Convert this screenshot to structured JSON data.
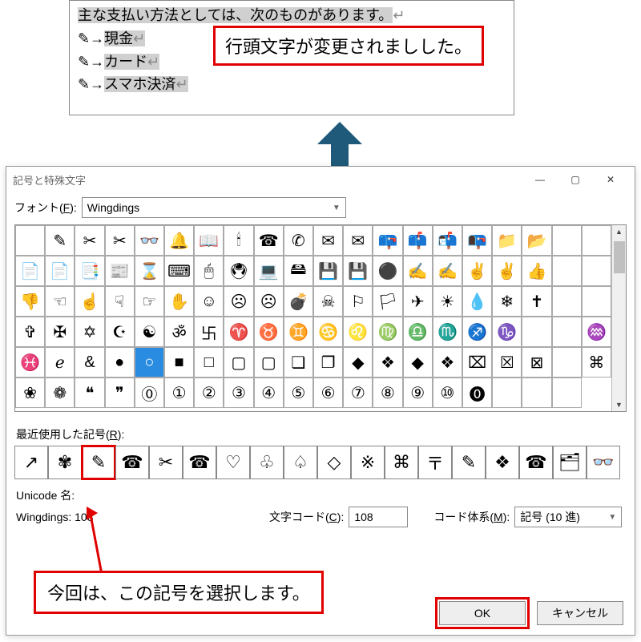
{
  "doc": {
    "heading": "主な支払い方法としては、次のものがあります。",
    "items": [
      "現金",
      "カード",
      "スマホ決済"
    ],
    "bullet_glyph": "✎",
    "tab_glyph": "→",
    "return_glyph": "↵"
  },
  "callout_top": "行頭文字が変更されましした。",
  "callout_bottom": "今回は、この記号を選択します。",
  "dialog": {
    "title": "記号と特殊文字",
    "minimize": "—",
    "maximize": "▢",
    "close": "✕",
    "font_label_pre": "フォント(",
    "font_label_key": "F",
    "font_label_post": "):",
    "font_value": "Wingdings",
    "recent_label_pre": "最近使用した記号(",
    "recent_label_key": "R",
    "recent_label_post": "):",
    "unicode_name": "Unicode 名:",
    "wingdings_name": "Wingdings: 108",
    "code_label_pre": "文字コード(",
    "code_label_key": "C",
    "code_label_post": "):",
    "code_value": "108",
    "system_label_pre": "コード体系(",
    "system_label_key": "M",
    "system_label_post": "):",
    "system_value": "記号 (10 進)",
    "ok": "OK",
    "cancel": "キャンセル",
    "grid": [
      "",
      "✎",
      "✂",
      "✂",
      "👓",
      "🔔",
      "📖",
      "🕯",
      "☎",
      "✆",
      "✉",
      "✉",
      "📪",
      "📫",
      "📬",
      "📭",
      "📁",
      "📂",
      "",
      "",
      "📄",
      "📄",
      "📑",
      "📰",
      "⌛",
      "⌨",
      "🖱",
      "🖲",
      "💻",
      "🖴",
      "💾",
      "💾",
      "⚫",
      "✍",
      "✍",
      "✌",
      "✌",
      "👍",
      "",
      "",
      "👎",
      "☜",
      "☝",
      "☟",
      "☞",
      "✋",
      "☺",
      "☹",
      "☹",
      "💣",
      "☠",
      "⚐",
      "🏳",
      "✈",
      "☀",
      "💧",
      "❄",
      "✝",
      "",
      "",
      "✞",
      "✠",
      "✡",
      "☪",
      "☯",
      "ॐ",
      "卐",
      "♈",
      "♉",
      "♊",
      "♋",
      "♌",
      "♍",
      "♎",
      "♏",
      "♐",
      "♑",
      "",
      "",
      "♒",
      "♓",
      "ℯ",
      "&",
      "●",
      "○",
      "■",
      "□",
      "▢",
      "▢",
      "❏",
      "❐",
      "◆",
      "❖",
      "◆",
      "❖",
      "⌧",
      "☒",
      "⊠",
      "",
      "⌘",
      "❀",
      "❁",
      "❝",
      "❞",
      "⓪",
      "①",
      "②",
      "③",
      "④",
      "⑤",
      "⑥",
      "⑦",
      "⑧",
      "⑨",
      "⑩",
      "⓿",
      "",
      "",
      ""
    ],
    "grid_selected_index": 84,
    "recent": [
      "↗",
      "✾",
      "✎",
      "☎",
      "✂",
      "☎",
      "♡",
      "♧",
      "♤",
      "◇",
      "※",
      "⌘",
      "〒",
      "✎",
      "❖",
      "☎",
      "🗂",
      "👓"
    ],
    "recent_highlight_index": 2
  }
}
